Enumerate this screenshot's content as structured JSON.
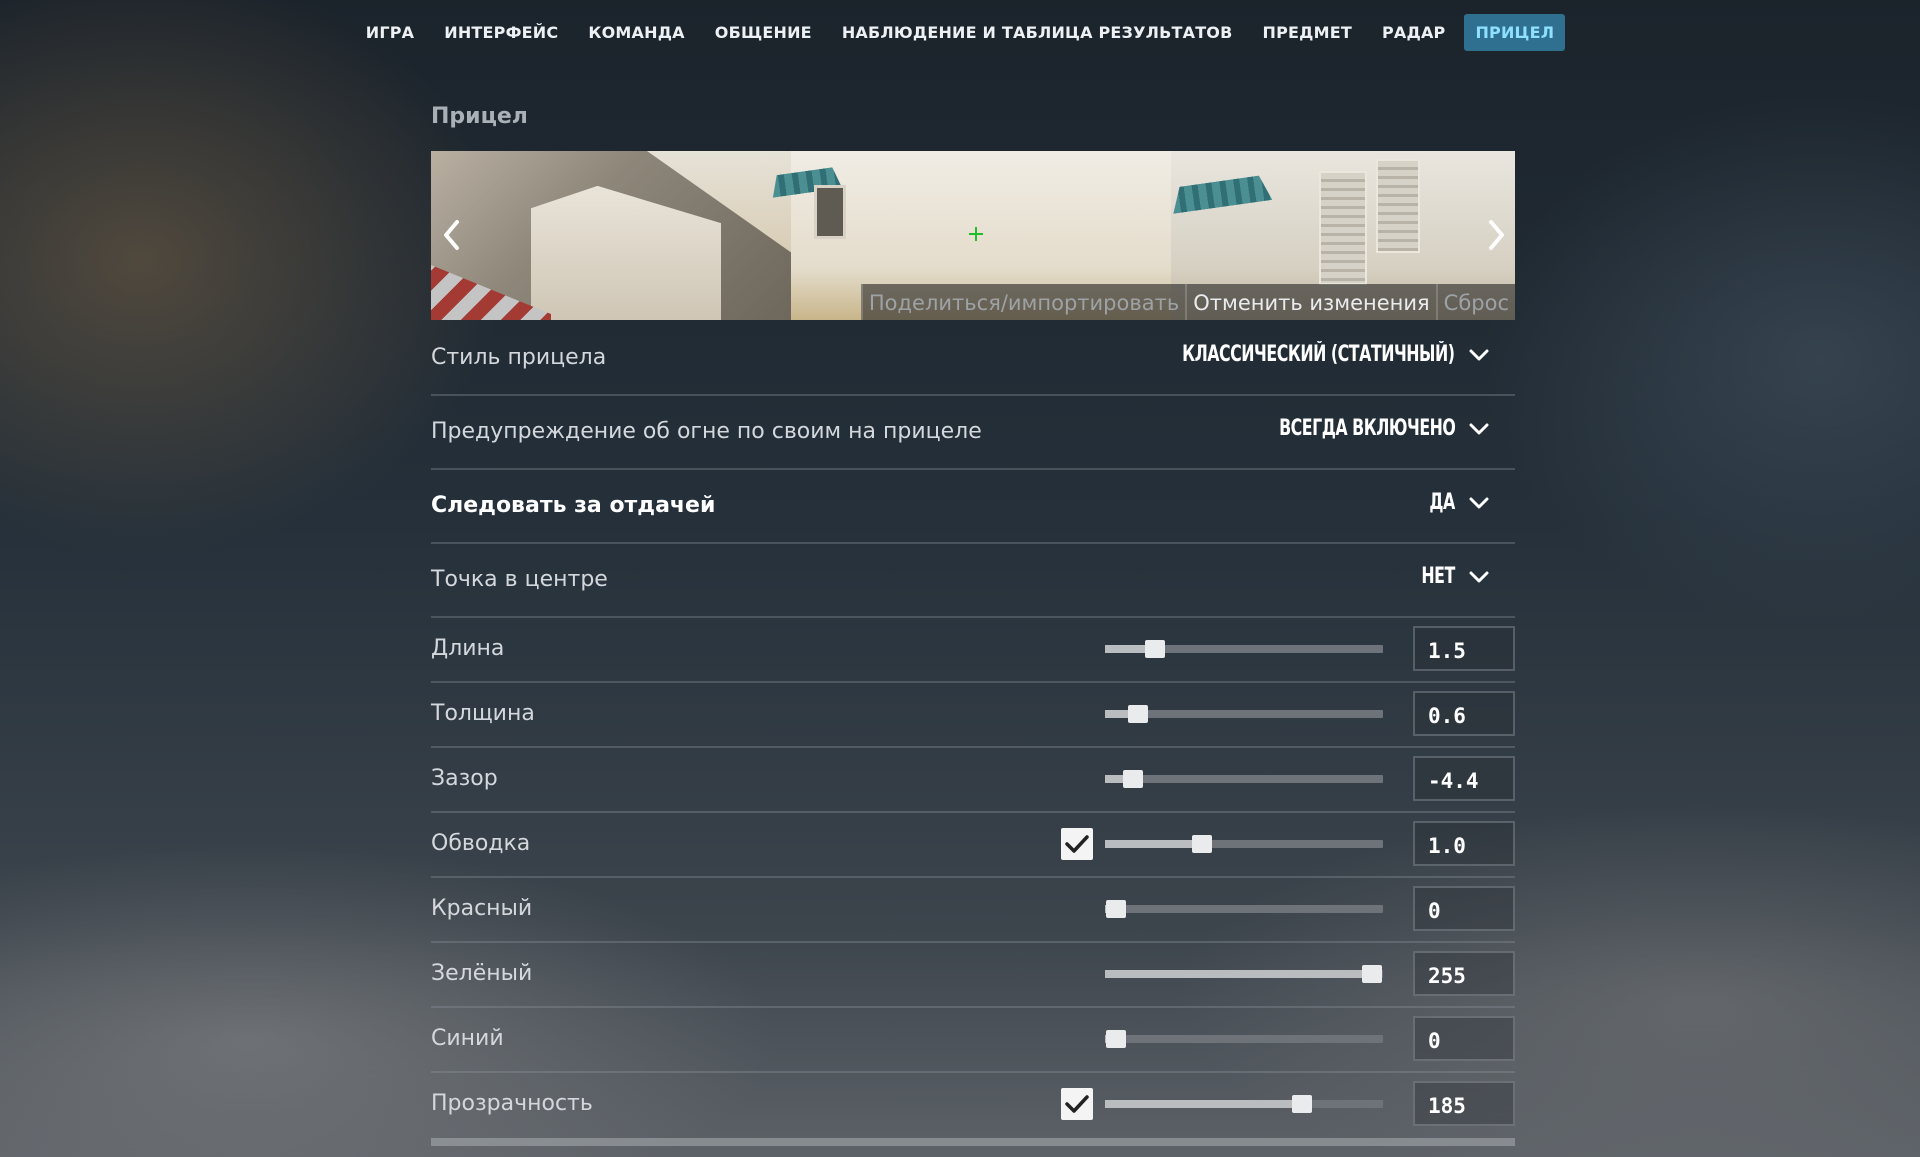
{
  "nav": {
    "tabs": [
      {
        "label": "ИГРА",
        "active": false
      },
      {
        "label": "ИНТЕРФЕЙС",
        "active": false
      },
      {
        "label": "КОМАНДА",
        "active": false
      },
      {
        "label": "ОБЩЕНИЕ",
        "active": false
      },
      {
        "label": "НАБЛЮДЕНИЕ И ТАБЛИЦА РЕЗУЛЬТАТОВ",
        "active": false
      },
      {
        "label": "ПРЕДМЕТ",
        "active": false
      },
      {
        "label": "РАДАР",
        "active": false
      },
      {
        "label": "ПРИЦЕЛ",
        "active": true
      }
    ]
  },
  "section": {
    "title": "Прицел"
  },
  "preview": {
    "share_label": "Поделиться/импортировать",
    "revert_label": "Отменить изменения",
    "reset_label": "Сброс",
    "crosshair_color": "#1fbf2c"
  },
  "settings": {
    "style": {
      "label": "Стиль прицела",
      "value": "Классический (статичный)"
    },
    "friendly_fire": {
      "label": "Предупреждение об огне по своим на прицеле",
      "value": "Всегда включено"
    },
    "follow_recoil": {
      "label": "Следовать за отдачей",
      "value": "Да"
    },
    "center_dot": {
      "label": "Точка в центре",
      "value": "Нет"
    }
  },
  "sliders": [
    {
      "label": "Длина",
      "value": "1.5",
      "fill": 0.18,
      "checkbox": false
    },
    {
      "label": "Толщина",
      "value": "0.6",
      "fill": 0.12,
      "checkbox": false
    },
    {
      "label": "Зазор",
      "value": "-4.4",
      "fill": 0.1,
      "checkbox": false
    },
    {
      "label": "Обводка",
      "value": "1.0",
      "fill": 0.35,
      "checkbox": true
    },
    {
      "label": "Красный",
      "value": "0",
      "fill": 0.04,
      "checkbox": false
    },
    {
      "label": "Зелёный",
      "value": "255",
      "fill": 0.96,
      "checkbox": false
    },
    {
      "label": "Синий",
      "value": "0",
      "fill": 0.04,
      "checkbox": false
    },
    {
      "label": "Прозрачность",
      "value": "185",
      "fill": 0.71,
      "checkbox": true
    }
  ],
  "colors": {
    "active_tab_bg": "#2f6f8f",
    "active_tab_text": "#8fe0ff"
  }
}
